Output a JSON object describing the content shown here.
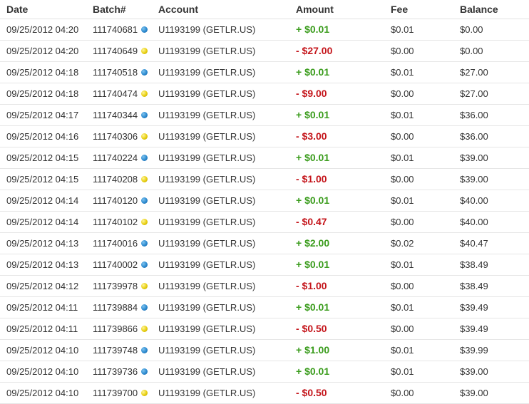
{
  "columns": {
    "date": "Date",
    "batch": "Batch#",
    "account": "Account",
    "amount": "Amount",
    "fee": "Fee",
    "balance": "Balance"
  },
  "colors": {
    "positive": "#3a9c1c",
    "negative": "#c4141a",
    "dot_blue": "#2c8ad0",
    "dot_yellow": "#e8cf11"
  },
  "rows": [
    {
      "date": "09/25/2012 04:20",
      "batch": "111740681",
      "dot": "blue-dot-icon",
      "account": "U1193199 (GETLR.US)",
      "amount": "+ $0.01",
      "sign": "pos",
      "fee": "$0.01",
      "balance": "$0.00"
    },
    {
      "date": "09/25/2012 04:20",
      "batch": "111740649",
      "dot": "yellow-dot-icon",
      "account": "U1193199 (GETLR.US)",
      "amount": "- $27.00",
      "sign": "neg",
      "fee": "$0.00",
      "balance": "$0.00"
    },
    {
      "date": "09/25/2012 04:18",
      "batch": "111740518",
      "dot": "blue-dot-icon",
      "account": "U1193199 (GETLR.US)",
      "amount": "+ $0.01",
      "sign": "pos",
      "fee": "$0.01",
      "balance": "$27.00"
    },
    {
      "date": "09/25/2012 04:18",
      "batch": "111740474",
      "dot": "yellow-dot-icon",
      "account": "U1193199 (GETLR.US)",
      "amount": "- $9.00",
      "sign": "neg",
      "fee": "$0.00",
      "balance": "$27.00"
    },
    {
      "date": "09/25/2012 04:17",
      "batch": "111740344",
      "dot": "blue-dot-icon",
      "account": "U1193199 (GETLR.US)",
      "amount": "+ $0.01",
      "sign": "pos",
      "fee": "$0.01",
      "balance": "$36.00"
    },
    {
      "date": "09/25/2012 04:16",
      "batch": "111740306",
      "dot": "yellow-dot-icon",
      "account": "U1193199 (GETLR.US)",
      "amount": "- $3.00",
      "sign": "neg",
      "fee": "$0.00",
      "balance": "$36.00"
    },
    {
      "date": "09/25/2012 04:15",
      "batch": "111740224",
      "dot": "blue-dot-icon",
      "account": "U1193199 (GETLR.US)",
      "amount": "+ $0.01",
      "sign": "pos",
      "fee": "$0.01",
      "balance": "$39.00"
    },
    {
      "date": "09/25/2012 04:15",
      "batch": "111740208",
      "dot": "yellow-dot-icon",
      "account": "U1193199 (GETLR.US)",
      "amount": "- $1.00",
      "sign": "neg",
      "fee": "$0.00",
      "balance": "$39.00"
    },
    {
      "date": "09/25/2012 04:14",
      "batch": "111740120",
      "dot": "blue-dot-icon",
      "account": "U1193199 (GETLR.US)",
      "amount": "+ $0.01",
      "sign": "pos",
      "fee": "$0.01",
      "balance": "$40.00"
    },
    {
      "date": "09/25/2012 04:14",
      "batch": "111740102",
      "dot": "yellow-dot-icon",
      "account": "U1193199 (GETLR.US)",
      "amount": "- $0.47",
      "sign": "neg",
      "fee": "$0.00",
      "balance": "$40.00"
    },
    {
      "date": "09/25/2012 04:13",
      "batch": "111740016",
      "dot": "blue-dot-icon",
      "account": "U1193199 (GETLR.US)",
      "amount": "+ $2.00",
      "sign": "pos",
      "fee": "$0.02",
      "balance": "$40.47"
    },
    {
      "date": "09/25/2012 04:13",
      "batch": "111740002",
      "dot": "blue-dot-icon",
      "account": "U1193199 (GETLR.US)",
      "amount": "+ $0.01",
      "sign": "pos",
      "fee": "$0.01",
      "balance": "$38.49"
    },
    {
      "date": "09/25/2012 04:12",
      "batch": "111739978",
      "dot": "yellow-dot-icon",
      "account": "U1193199 (GETLR.US)",
      "amount": "- $1.00",
      "sign": "neg",
      "fee": "$0.00",
      "balance": "$38.49"
    },
    {
      "date": "09/25/2012 04:11",
      "batch": "111739884",
      "dot": "blue-dot-icon",
      "account": "U1193199 (GETLR.US)",
      "amount": "+ $0.01",
      "sign": "pos",
      "fee": "$0.01",
      "balance": "$39.49"
    },
    {
      "date": "09/25/2012 04:11",
      "batch": "111739866",
      "dot": "yellow-dot-icon",
      "account": "U1193199 (GETLR.US)",
      "amount": "- $0.50",
      "sign": "neg",
      "fee": "$0.00",
      "balance": "$39.49"
    },
    {
      "date": "09/25/2012 04:10",
      "batch": "111739748",
      "dot": "blue-dot-icon",
      "account": "U1193199 (GETLR.US)",
      "amount": "+ $1.00",
      "sign": "pos",
      "fee": "$0.01",
      "balance": "$39.99"
    },
    {
      "date": "09/25/2012 04:10",
      "batch": "111739736",
      "dot": "blue-dot-icon",
      "account": "U1193199 (GETLR.US)",
      "amount": "+ $0.01",
      "sign": "pos",
      "fee": "$0.01",
      "balance": "$39.00"
    },
    {
      "date": "09/25/2012 04:10",
      "batch": "111739700",
      "dot": "yellow-dot-icon",
      "account": "U1193199 (GETLR.US)",
      "amount": "- $0.50",
      "sign": "neg",
      "fee": "$0.00",
      "balance": "$39.00"
    }
  ]
}
